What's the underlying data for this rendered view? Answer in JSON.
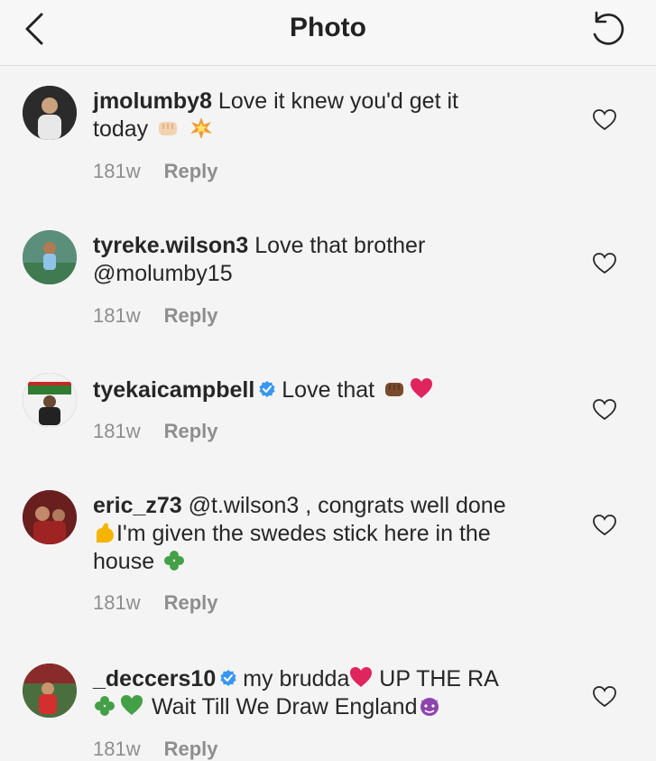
{
  "header": {
    "title": "Photo",
    "back_icon": "chevron-left-icon",
    "refresh_icon": "refresh-icon"
  },
  "colors": {
    "verified": "#3897f0",
    "heart": "#e0245e",
    "meta_text": "#8e8e8e"
  },
  "comments": [
    {
      "username": "jmolumby8",
      "text_1": " Love it knew you'd get it",
      "text_2": "today",
      "emojis": [
        "fist-emoji",
        "collision-emoji"
      ],
      "time": "181w",
      "reply": "Reply"
    },
    {
      "username": "tyreke.wilson3",
      "text_1": " Love that brother",
      "mention": "@molumby15",
      "time": "181w",
      "reply": "Reply"
    },
    {
      "username": "tyekaicampbell",
      "verified": true,
      "text_1": "Love that",
      "emojis": [
        "fist-emoji",
        "red-heart-emoji"
      ],
      "time": "181w",
      "reply": "Reply"
    },
    {
      "username": "eric_z73",
      "mention": " @t.wilson3",
      "text_1": " , congrats well done",
      "text_2": "I'm given the swedes stick here in the",
      "text_3": "house",
      "emojis": [
        "flexed-biceps-emoji",
        "shamrock-emoji"
      ],
      "time": "181w",
      "reply": "Reply"
    },
    {
      "username": "_deccers10",
      "verified": true,
      "text_1": "my brudda",
      "text_2": " UP THE RA",
      "text_3": " Wait Till We Draw England",
      "emojis": [
        "red-heart-emoji",
        "shamrock-emoji",
        "green-heart-emoji",
        "imp-emoji"
      ],
      "time": "181w",
      "reply": "Reply"
    }
  ]
}
